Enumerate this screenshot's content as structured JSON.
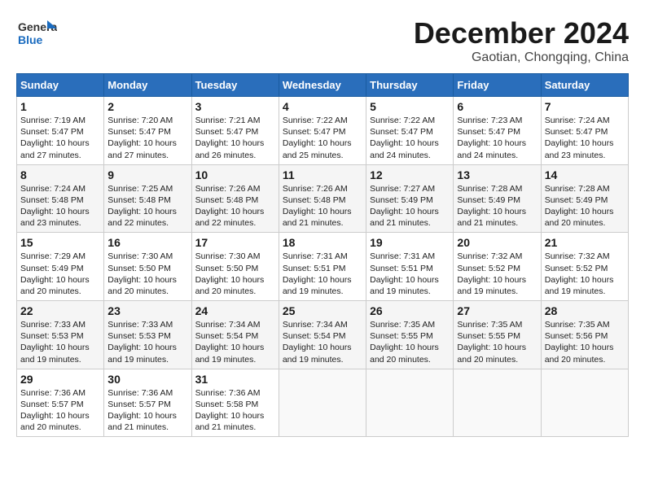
{
  "header": {
    "logo_general": "General",
    "logo_blue": "Blue",
    "month": "December 2024",
    "location": "Gaotian, Chongqing, China"
  },
  "weekdays": [
    "Sunday",
    "Monday",
    "Tuesday",
    "Wednesday",
    "Thursday",
    "Friday",
    "Saturday"
  ],
  "weeks": [
    [
      {
        "day": "1",
        "info": "Sunrise: 7:19 AM\nSunset: 5:47 PM\nDaylight: 10 hours and 27 minutes."
      },
      {
        "day": "2",
        "info": "Sunrise: 7:20 AM\nSunset: 5:47 PM\nDaylight: 10 hours and 27 minutes."
      },
      {
        "day": "3",
        "info": "Sunrise: 7:21 AM\nSunset: 5:47 PM\nDaylight: 10 hours and 26 minutes."
      },
      {
        "day": "4",
        "info": "Sunrise: 7:22 AM\nSunset: 5:47 PM\nDaylight: 10 hours and 25 minutes."
      },
      {
        "day": "5",
        "info": "Sunrise: 7:22 AM\nSunset: 5:47 PM\nDaylight: 10 hours and 24 minutes."
      },
      {
        "day": "6",
        "info": "Sunrise: 7:23 AM\nSunset: 5:47 PM\nDaylight: 10 hours and 24 minutes."
      },
      {
        "day": "7",
        "info": "Sunrise: 7:24 AM\nSunset: 5:47 PM\nDaylight: 10 hours and 23 minutes."
      }
    ],
    [
      {
        "day": "8",
        "info": "Sunrise: 7:24 AM\nSunset: 5:48 PM\nDaylight: 10 hours and 23 minutes."
      },
      {
        "day": "9",
        "info": "Sunrise: 7:25 AM\nSunset: 5:48 PM\nDaylight: 10 hours and 22 minutes."
      },
      {
        "day": "10",
        "info": "Sunrise: 7:26 AM\nSunset: 5:48 PM\nDaylight: 10 hours and 22 minutes."
      },
      {
        "day": "11",
        "info": "Sunrise: 7:26 AM\nSunset: 5:48 PM\nDaylight: 10 hours and 21 minutes."
      },
      {
        "day": "12",
        "info": "Sunrise: 7:27 AM\nSunset: 5:49 PM\nDaylight: 10 hours and 21 minutes."
      },
      {
        "day": "13",
        "info": "Sunrise: 7:28 AM\nSunset: 5:49 PM\nDaylight: 10 hours and 21 minutes."
      },
      {
        "day": "14",
        "info": "Sunrise: 7:28 AM\nSunset: 5:49 PM\nDaylight: 10 hours and 20 minutes."
      }
    ],
    [
      {
        "day": "15",
        "info": "Sunrise: 7:29 AM\nSunset: 5:49 PM\nDaylight: 10 hours and 20 minutes."
      },
      {
        "day": "16",
        "info": "Sunrise: 7:30 AM\nSunset: 5:50 PM\nDaylight: 10 hours and 20 minutes."
      },
      {
        "day": "17",
        "info": "Sunrise: 7:30 AM\nSunset: 5:50 PM\nDaylight: 10 hours and 20 minutes."
      },
      {
        "day": "18",
        "info": "Sunrise: 7:31 AM\nSunset: 5:51 PM\nDaylight: 10 hours and 19 minutes."
      },
      {
        "day": "19",
        "info": "Sunrise: 7:31 AM\nSunset: 5:51 PM\nDaylight: 10 hours and 19 minutes."
      },
      {
        "day": "20",
        "info": "Sunrise: 7:32 AM\nSunset: 5:52 PM\nDaylight: 10 hours and 19 minutes."
      },
      {
        "day": "21",
        "info": "Sunrise: 7:32 AM\nSunset: 5:52 PM\nDaylight: 10 hours and 19 minutes."
      }
    ],
    [
      {
        "day": "22",
        "info": "Sunrise: 7:33 AM\nSunset: 5:53 PM\nDaylight: 10 hours and 19 minutes."
      },
      {
        "day": "23",
        "info": "Sunrise: 7:33 AM\nSunset: 5:53 PM\nDaylight: 10 hours and 19 minutes."
      },
      {
        "day": "24",
        "info": "Sunrise: 7:34 AM\nSunset: 5:54 PM\nDaylight: 10 hours and 19 minutes."
      },
      {
        "day": "25",
        "info": "Sunrise: 7:34 AM\nSunset: 5:54 PM\nDaylight: 10 hours and 19 minutes."
      },
      {
        "day": "26",
        "info": "Sunrise: 7:35 AM\nSunset: 5:55 PM\nDaylight: 10 hours and 20 minutes."
      },
      {
        "day": "27",
        "info": "Sunrise: 7:35 AM\nSunset: 5:55 PM\nDaylight: 10 hours and 20 minutes."
      },
      {
        "day": "28",
        "info": "Sunrise: 7:35 AM\nSunset: 5:56 PM\nDaylight: 10 hours and 20 minutes."
      }
    ],
    [
      {
        "day": "29",
        "info": "Sunrise: 7:36 AM\nSunset: 5:57 PM\nDaylight: 10 hours and 20 minutes."
      },
      {
        "day": "30",
        "info": "Sunrise: 7:36 AM\nSunset: 5:57 PM\nDaylight: 10 hours and 21 minutes."
      },
      {
        "day": "31",
        "info": "Sunrise: 7:36 AM\nSunset: 5:58 PM\nDaylight: 10 hours and 21 minutes."
      },
      {
        "day": "",
        "info": ""
      },
      {
        "day": "",
        "info": ""
      },
      {
        "day": "",
        "info": ""
      },
      {
        "day": "",
        "info": ""
      }
    ]
  ]
}
